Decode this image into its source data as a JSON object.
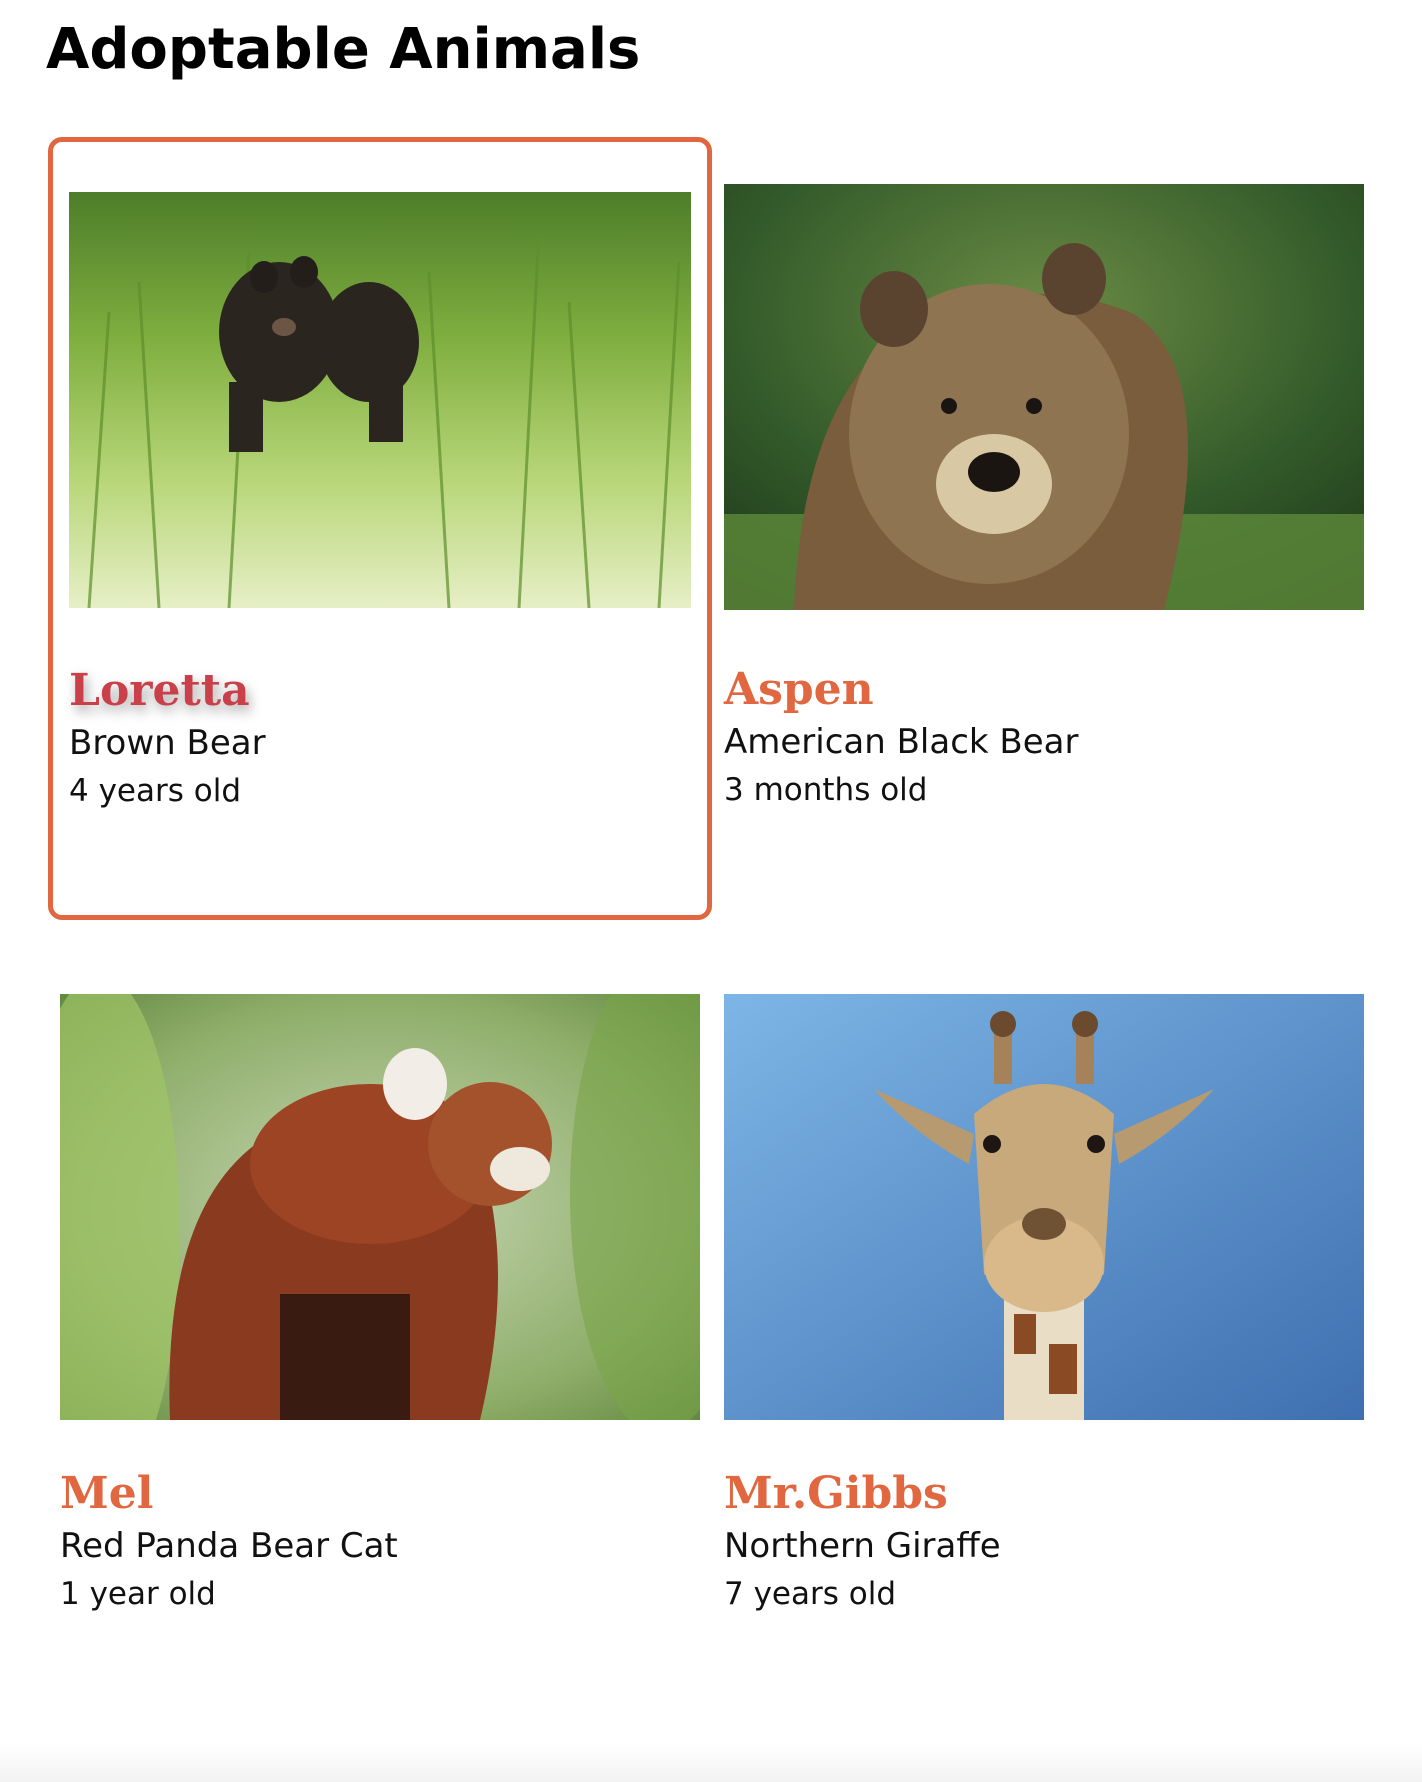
{
  "page": {
    "title": "Adoptable Animals"
  },
  "colors": {
    "accent": "#e0673f",
    "hover_name": "#c9404a",
    "selected_border": "#e0673f"
  },
  "animals": [
    {
      "name": "Loretta",
      "species": "Brown Bear",
      "age": "4 years old",
      "photo_subject": "black-bear-in-meadow",
      "selected": true
    },
    {
      "name": "Aspen",
      "species": "American Black Bear",
      "age": "3 months old",
      "photo_subject": "grizzly-bear-portrait",
      "selected": false
    },
    {
      "name": "Mel",
      "species": "Red Panda Bear Cat",
      "age": "1 year old",
      "photo_subject": "red-panda-in-foliage",
      "selected": false
    },
    {
      "name": "Mr.Gibbs",
      "species": "Northern Giraffe",
      "age": "7 years old",
      "photo_subject": "giraffe-head-blue-sky",
      "selected": false
    }
  ]
}
